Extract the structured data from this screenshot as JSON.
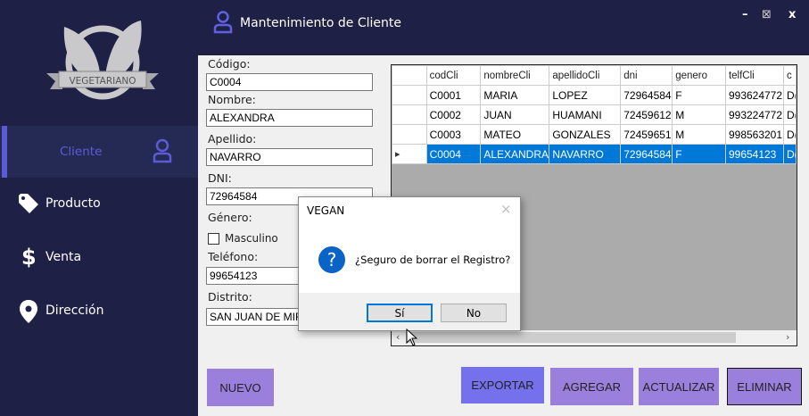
{
  "header": {
    "title": "Mantenimiento de Cliente",
    "minimize": "–",
    "maximize": "⊠",
    "close": "x"
  },
  "logo": {
    "text": "VEGETARIANO"
  },
  "sidebar": {
    "items": [
      {
        "label": "Cliente",
        "icon": "user-icon",
        "active": true
      },
      {
        "label": "Producto",
        "icon": "tag-icon"
      },
      {
        "label": "Venta",
        "icon": "dollar-icon"
      },
      {
        "label": "Dirección",
        "icon": "location-pin-icon"
      }
    ]
  },
  "form": {
    "codigo": {
      "label": "Código:",
      "value": "C0004"
    },
    "nombre": {
      "label": "Nombre:",
      "value": "ALEXANDRA"
    },
    "apellido": {
      "label": "Apellido:",
      "value": "NAVARRO"
    },
    "dni": {
      "label": "DNI:",
      "value": "72964584"
    },
    "genero": {
      "label": "Género:",
      "option": "Masculino"
    },
    "telefono": {
      "label": "Teléfono:",
      "value": "99654123"
    },
    "distrito": {
      "label": "Distrito:",
      "value": "SAN JUAN DE MIRA"
    }
  },
  "grid": {
    "columns": [
      "codCli",
      "nombreCli",
      "apellidoCli",
      "dni",
      "genero",
      "telfCli",
      "c"
    ],
    "rows": [
      [
        "C0001",
        "MARIA",
        "LOPEZ",
        "72964584",
        "F",
        "993624772",
        "D("
      ],
      [
        "C0002",
        "JUAN",
        "HUAMANI",
        "72459612",
        "M",
        "993224772",
        "D("
      ],
      [
        "C0003",
        "MATEO",
        "GONZALES",
        "72459651",
        "M",
        "998563201",
        "D("
      ],
      [
        "C0004",
        "ALEXANDRA",
        "NAVARRO",
        "72964584",
        "F",
        "99654123",
        "D("
      ]
    ],
    "selected_row": 3
  },
  "buttons": {
    "nuevo": "NUEVO",
    "exportar": "EXPORTAR",
    "agregar": "AGREGAR",
    "actualizar": "ACTUALIZAR",
    "eliminar": "ELIMINAR"
  },
  "dialog": {
    "title": "VEGAN",
    "message": "¿Seguro de borrar el Registro?",
    "yes": "Sí",
    "no": "No"
  },
  "colors": {
    "sidebar": "#1f2046",
    "accent": "#5b5bd6",
    "button": "#9b7fdc",
    "export": "#7570ec",
    "selection": "#0078d7"
  }
}
